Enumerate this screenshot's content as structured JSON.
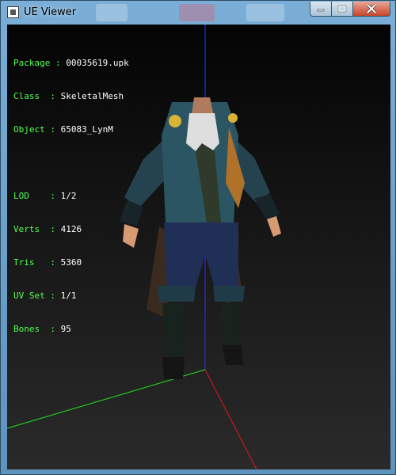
{
  "window": {
    "title": "UE Viewer",
    "controls": {
      "minimize": "minimize",
      "maximize": "maximize",
      "close": "close"
    }
  },
  "info": {
    "package": {
      "key": "Package",
      "sep": " : ",
      "value": "00035619.upk"
    },
    "class": {
      "key": "Class",
      "sep": "  : ",
      "value": "SkeletalMesh"
    },
    "object": {
      "key": "Object",
      "sep": " : ",
      "value": "65083_LynM"
    },
    "lod": {
      "key": "LOD",
      "sep": "    : ",
      "value": "1/2"
    },
    "verts": {
      "key": "Verts",
      "sep": "  : ",
      "value": "4126"
    },
    "tris": {
      "key": "Tris",
      "sep": "   : ",
      "value": "5360"
    },
    "uvset": {
      "key": "UV Set",
      "sep": " : ",
      "value": "1/1"
    },
    "bones": {
      "key": "Bones",
      "sep": "  : ",
      "value": "95"
    }
  },
  "colors": {
    "label": "#54ff54",
    "value": "#ffffff",
    "axis_x": "#c21a1a",
    "axis_y": "#22c522",
    "axis_z": "#2a2ae0"
  }
}
